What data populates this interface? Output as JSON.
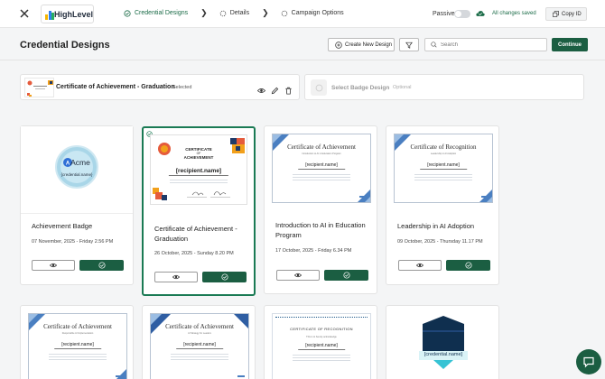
{
  "topbar": {
    "logo_text": "HighLevel",
    "steps": [
      {
        "label": "Credential Designs",
        "active": true
      },
      {
        "label": "Details",
        "active": false
      },
      {
        "label": "Campaign Options",
        "active": false
      }
    ],
    "passive_label": "Passive",
    "passive_on": false,
    "saved_text": "All changes saved",
    "copy_id_label": "Copy ID"
  },
  "header": {
    "title": "Credential Designs",
    "create_label": "Create New Design",
    "search_placeholder": "Search",
    "continue_label": "Continue"
  },
  "selection": {
    "name": "Certificate of Achievement - Graduation",
    "status": "Selected",
    "badge_title": "Select Badge Design",
    "badge_optional": "Optional"
  },
  "cards": [
    {
      "title": "Achievement Badge",
      "date": "07 November, 2025 - Friday 2.56 PM",
      "selected": false,
      "badge": {
        "brand": "Acme",
        "name": "{credential.name}"
      }
    },
    {
      "title": "Certificate of Achievement - Graduation",
      "date": "26 October, 2025 - Sunday 8.20 PM",
      "selected": true,
      "cert": {
        "title_line1": "CERTIFICATE",
        "title_line2": "OF",
        "title_line3": "ACHIEVEMENT",
        "name": "[recipient.name]"
      }
    },
    {
      "title": "Introduction to AI in Education Program",
      "date": "17 October, 2025 - Friday 6.34 PM",
      "selected": false,
      "cert": {
        "title": "Certificate of Achievement",
        "subtitle": "Introduction to AI in Education Program",
        "name": "[recipient.name]"
      }
    },
    {
      "title": "Leadership in AI Adoption",
      "date": "09 October, 2025 - Thursday 11.17 PM",
      "selected": false,
      "cert": {
        "title": "Certificate of Recognition",
        "subtitle": "Leadership in AI Adoption",
        "name": "[recipient.name]"
      }
    }
  ],
  "row2": [
    {
      "cert": {
        "title": "Certificate of Achievement",
        "subtitle": "Responsible AI Implementation",
        "name": "[recipient.name]"
      }
    },
    {
      "cert": {
        "title": "Certificate of Achievement",
        "subtitle": "AI Strategy for Leaders",
        "name": "[recipient.name]"
      }
    },
    {
      "cert": {
        "title": "CERTIFICATE OF RECOGNITION",
        "subtitle": "This is to hereby acknowledge",
        "name": "[recipient.name]"
      }
    },
    {
      "cert": {
        "name": "[credential.name]"
      }
    }
  ],
  "colors": {
    "brand_green": "#1b5e42",
    "accent_green": "#1a7a54",
    "cert_blue": "#4a7fc1"
  },
  "icons": [
    "close-icon",
    "check-circle-icon",
    "spinner-icon",
    "chevron-right-icon",
    "cloud-check-icon",
    "copy-icon",
    "plus-circle-icon",
    "filter-icon",
    "search-icon",
    "eye-icon",
    "pencil-icon",
    "trash-icon",
    "chat-icon"
  ]
}
